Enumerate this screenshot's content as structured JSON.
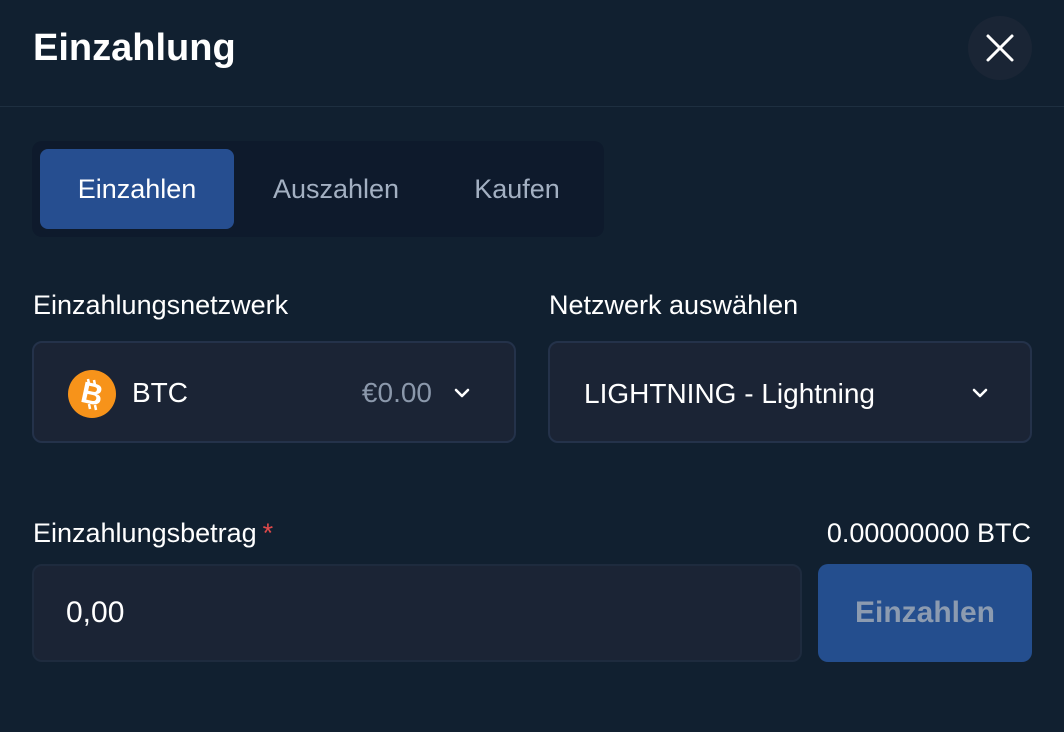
{
  "dialog": {
    "title": "Einzahlung"
  },
  "tabs": [
    {
      "label": "Einzahlen",
      "active": true
    },
    {
      "label": "Auszahlen",
      "active": false
    },
    {
      "label": "Kaufen",
      "active": false
    }
  ],
  "deposit_network": {
    "label": "Einzahlungsnetzwerk",
    "coin_icon": "bitcoin-icon",
    "coin_name": "BTC",
    "coin_value": "€0.00"
  },
  "network_select": {
    "label": "Netzwerk auswählen",
    "value": "LIGHTNING - Lightning"
  },
  "amount": {
    "label": "Einzahlungsbetrag",
    "required_marker": "*",
    "balance": "0.00000000 BTC",
    "value": "0,00"
  },
  "submit": {
    "label": "Einzahlen"
  },
  "colors": {
    "background": "#112030",
    "accent": "#264e90",
    "bitcoin": "#f7931a",
    "required": "#e0494a"
  }
}
